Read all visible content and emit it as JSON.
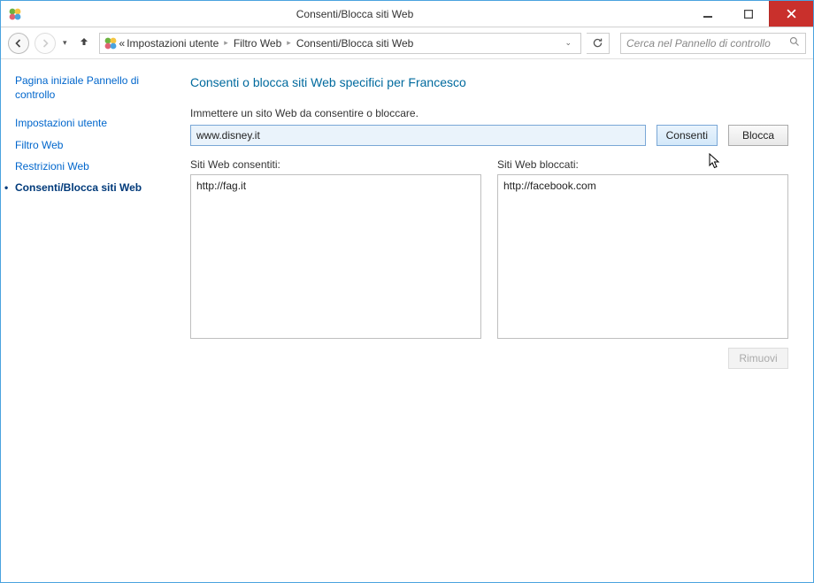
{
  "window": {
    "title": "Consenti/Blocca siti Web"
  },
  "breadcrumb": {
    "prefix": "«",
    "items": [
      "Impostazioni utente",
      "Filtro Web",
      "Consenti/Blocca siti Web"
    ]
  },
  "search": {
    "placeholder": "Cerca nel Pannello di controllo"
  },
  "sidebar": {
    "home": "Pagina iniziale Pannello di controllo",
    "items": [
      {
        "label": "Impostazioni utente"
      },
      {
        "label": "Filtro Web"
      },
      {
        "label": "Restrizioni Web"
      },
      {
        "label": "Consenti/Blocca siti Web",
        "current": true
      }
    ]
  },
  "content": {
    "title": "Consenti o blocca siti Web specifici per Francesco",
    "instruction": "Immettere un sito Web da consentire o bloccare.",
    "input_value": "www.disney.it",
    "allow_button": "Consenti",
    "block_button": "Blocca",
    "allowed_label": "Siti Web consentiti:",
    "blocked_label": "Siti Web bloccati:",
    "allowed_sites": [
      "http://fag.it"
    ],
    "blocked_sites": [
      "http://facebook.com"
    ],
    "remove_button": "Rimuovi"
  }
}
